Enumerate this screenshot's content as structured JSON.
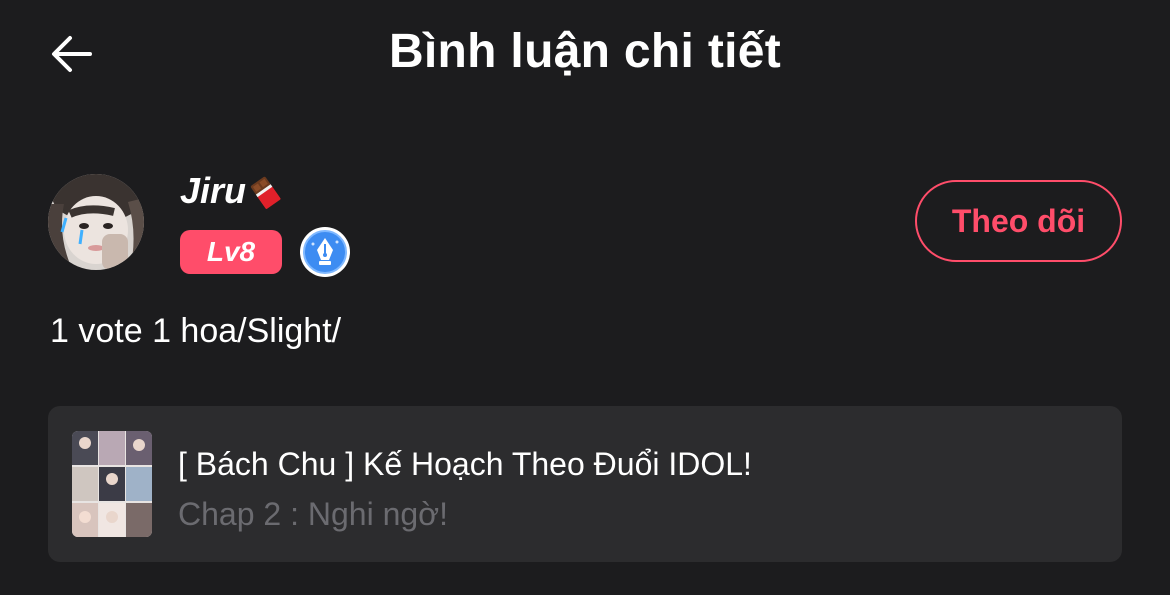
{
  "header": {
    "title": "Bình luận chi tiết",
    "back_icon": "arrow-left-icon"
  },
  "author": {
    "name": "Jiru",
    "name_icon": "chocolate-icon",
    "level": "Lv8",
    "writer_badge_icon": "pen-nib-badge-icon",
    "follow_label": "Theo dõi"
  },
  "comment": {
    "text": "1 vote 1 hoa/Slight/"
  },
  "story": {
    "title": "[ Bách Chu ] Kế Hoạch Theo Đuổi IDOL!",
    "chapter": "Chap 2 : Nghi ngờ!"
  },
  "colors": {
    "background": "#1c1c1e",
    "card": "#2c2c2e",
    "accent": "#ff4d6a",
    "muted_text": "#6b6b70"
  }
}
